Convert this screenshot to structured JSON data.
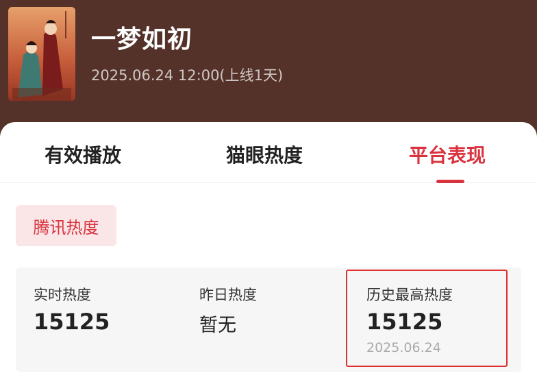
{
  "header": {
    "title": "一梦如初",
    "release_info": "2025.06.24 12:00(上线1天)",
    "background_color": "#553229"
  },
  "tabs": [
    {
      "label": "有效播放",
      "active": false
    },
    {
      "label": "猫眼热度",
      "active": false
    },
    {
      "label": "平台表现",
      "active": true
    }
  ],
  "platform_chip": {
    "label": "腾讯热度"
  },
  "stats": {
    "realtime": {
      "label": "实时热度",
      "value": "15125"
    },
    "yesterday": {
      "label": "昨日热度",
      "value": "暂无"
    },
    "history_high": {
      "label": "历史最高热度",
      "value": "15125",
      "date": "2025.06.24"
    }
  },
  "colors": {
    "accent": "#d9333f",
    "highlight_border": "#e03030"
  }
}
